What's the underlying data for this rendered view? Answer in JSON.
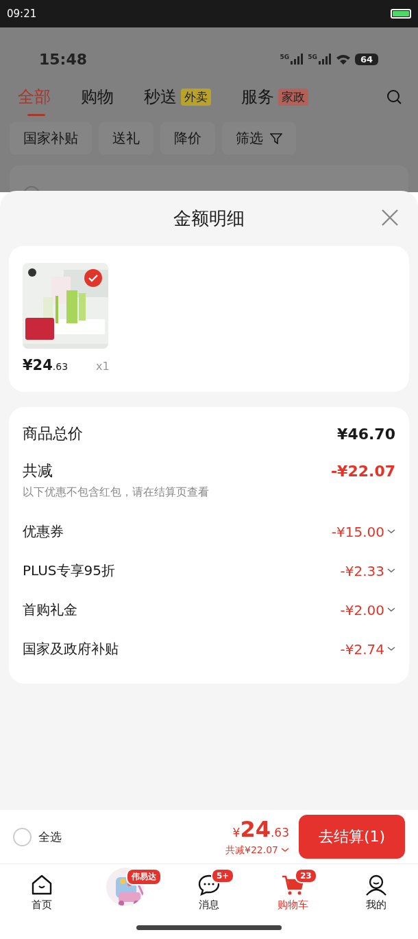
{
  "phone_status": {
    "time": "09:21"
  },
  "page": {
    "status_time": "15:48",
    "network": [
      "5G",
      "5G"
    ],
    "battery": "64",
    "tabs": [
      {
        "label": "全部",
        "selected": true
      },
      {
        "label": "购物",
        "selected": false
      },
      {
        "label": "秒送",
        "badge": "外卖",
        "color": "#b8a22a",
        "selected": false
      },
      {
        "label": "服务",
        "badge": "家政",
        "color": "#b3625a",
        "selected": false
      }
    ],
    "filters": [
      {
        "label": "国家补贴",
        "kind": "plain"
      },
      {
        "label": "送礼",
        "kind": "plain"
      },
      {
        "label": "降价",
        "kind": "plain"
      },
      {
        "label": "筛选",
        "kind": "filter"
      }
    ]
  },
  "sheet": {
    "title": "金额明细",
    "product": {
      "kind": "picture",
      "checked": true,
      "price_symbol": "¥",
      "price_main": "24",
      "price_decimal": ".63",
      "quantity": "x1"
    },
    "summary": {
      "total_label": "商品总价",
      "total": "¥46.70",
      "discount_label": "共减",
      "discount": "-¥22.07",
      "note": "以下优惠不包含红包，请在结算页查看",
      "items": [
        {
          "label": "优惠券",
          "amount": "-¥15.00"
        },
        {
          "label": "PLUS专享95折",
          "amount": "-¥2.33"
        },
        {
          "label": "首购礼金",
          "amount": "-¥2.00"
        },
        {
          "label": "国家及政府补贴",
          "amount": "-¥2.74"
        }
      ]
    }
  },
  "bottom_bar": {
    "select_all_label": "全选",
    "select_all_checked": false,
    "price_symbol": "¥",
    "price_main": "24",
    "price_decimal": ".63",
    "saved": "共减¥22.07",
    "checkout": "去结算(1)"
  },
  "nav": [
    {
      "kind": "home",
      "label": "首页",
      "selected": false
    },
    {
      "kind": "picture",
      "badge": "伟易达",
      "selected": false
    },
    {
      "kind": "message",
      "label": "消息",
      "badge": "5+",
      "selected": false
    },
    {
      "kind": "cart",
      "label": "购物车",
      "badge": "23",
      "selected": true
    },
    {
      "kind": "profile",
      "label": "我的",
      "selected": false
    }
  ]
}
